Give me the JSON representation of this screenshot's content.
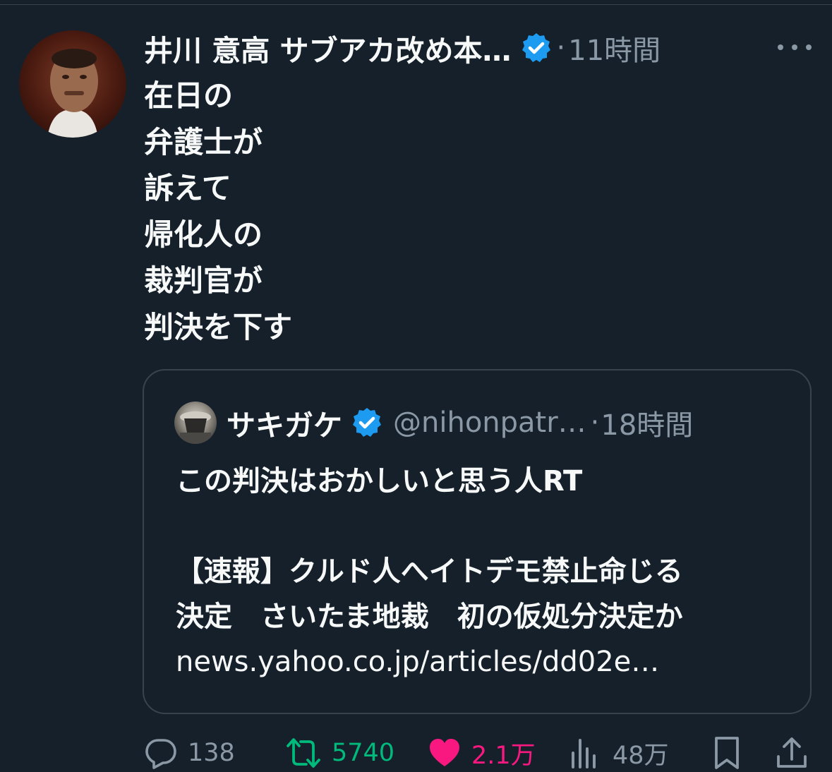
{
  "tweet": {
    "author_name": "井川 意高 サブアカ改め本…",
    "separator": "·",
    "timestamp": "11時間",
    "body_lines": [
      "在日の",
      "弁護士が",
      "訴えて",
      "帰化人の",
      "裁判官が",
      "判決を下す"
    ],
    "colors": {
      "background": "#15202b",
      "muted": "#8b98a5",
      "verified": "#1d9bf0",
      "retweet": "#00ba7c",
      "like": "#f91880"
    }
  },
  "quoted": {
    "name": "サキガケ",
    "handle": "@nihonpatr…",
    "separator": "·",
    "timestamp": "18時間",
    "line1": "この判決はおかしいと思う人RT",
    "line2": "【速報】クルド人へイトデモ禁止命じる",
    "line3": "決定　さいたま地裁　初の仮処分決定か",
    "link": "news.yahoo.co.jp/articles/dd02e…"
  },
  "actions": {
    "reply_count": "138",
    "retweet_count": "5740",
    "like_count": "2.1万",
    "views_count": "48万",
    "icons": [
      "reply-icon",
      "retweet-icon",
      "like-icon",
      "views-icon",
      "bookmark-icon",
      "share-icon"
    ]
  }
}
